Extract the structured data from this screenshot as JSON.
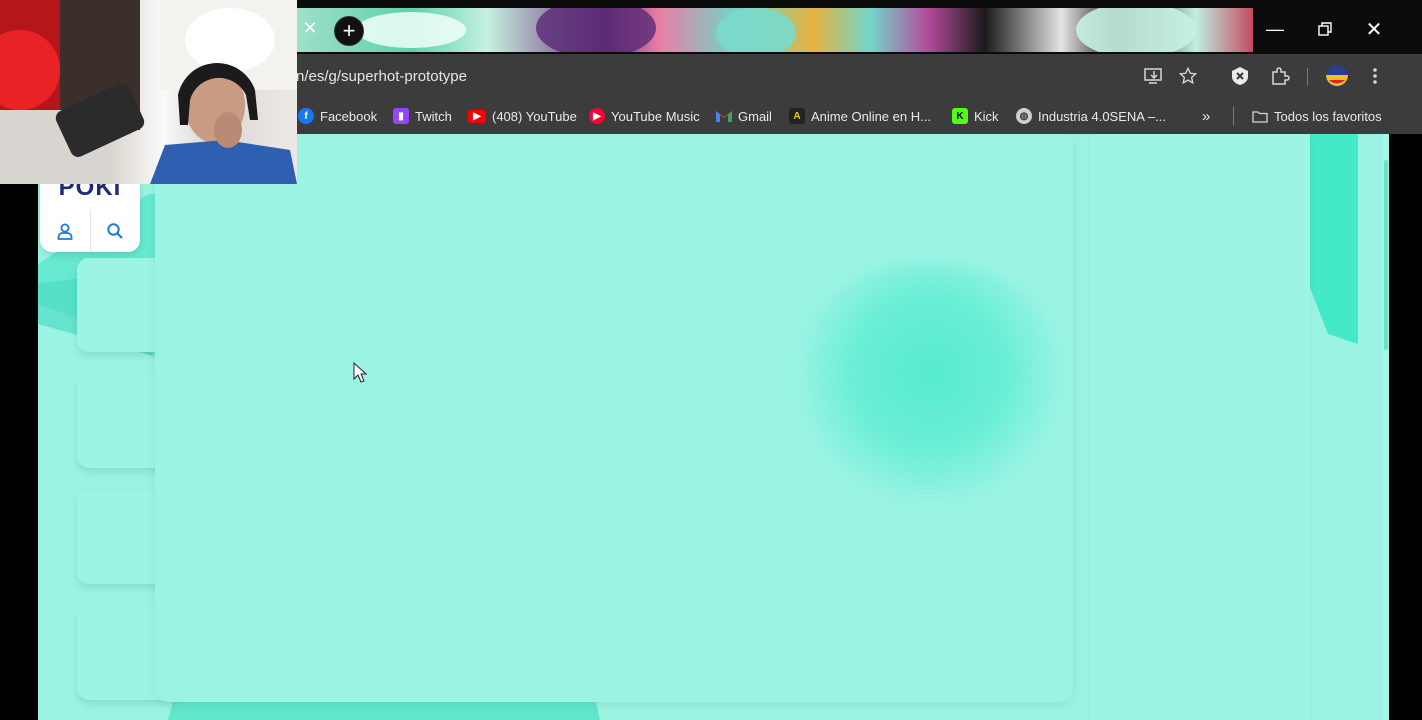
{
  "browser": {
    "url": "n/es/g/superhot-prototype",
    "bookmarks": [
      {
        "label": "Facebook",
        "icon": "facebook-icon",
        "color": "#1877f2"
      },
      {
        "label": "Twitch",
        "icon": "twitch-icon",
        "color": "#9146ff"
      },
      {
        "label": "(408) YouTube",
        "icon": "youtube-icon",
        "color": "#ff0000"
      },
      {
        "label": "YouTube Music",
        "icon": "youtube-music-icon",
        "color": "#ff0033"
      },
      {
        "label": "Gmail",
        "icon": "gmail-icon",
        "color": "#ea4335"
      },
      {
        "label": "Anime Online en H...",
        "icon": "anime-icon",
        "color": "#222222"
      },
      {
        "label": "Kick",
        "icon": "kick-icon",
        "color": "#53fc18"
      },
      {
        "label": "Industria 4.0SENA –...",
        "icon": "globe-icon",
        "color": "#cfcfcf"
      }
    ],
    "all_bookmarks_label": "Todos los favoritos"
  },
  "site": {
    "logo_text": "POKI",
    "accent_color": "#9bf4e3",
    "brand_color": "#1c2b73"
  }
}
